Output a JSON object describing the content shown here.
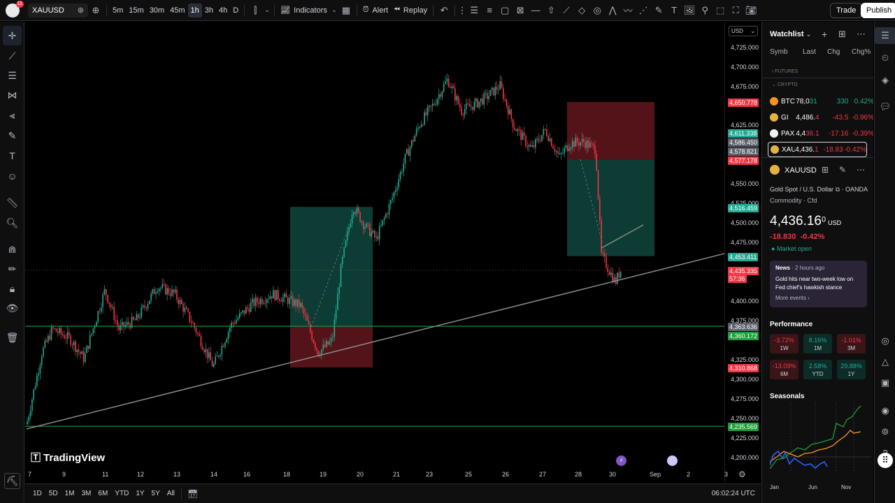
{
  "topbar": {
    "avatar_badge": "11",
    "symbol": "XAUUSD",
    "timeframes": [
      "5m",
      "15m",
      "30m",
      "45m",
      "1h",
      "3h",
      "4h",
      "D"
    ],
    "active_timeframe": "1h",
    "indicators_label": "Indicators",
    "alert_label": "Alert",
    "replay_label": "Replay",
    "trade_label": "Trade",
    "publish_label": "Publish"
  },
  "chart": {
    "currency": "USD",
    "logo_text": "TradingView",
    "price_ticks": [
      "4,725.000",
      "4,700.000",
      "4,675.000",
      "4,625.000",
      "4,550.000",
      "4,525.000",
      "4,500.000",
      "4,475.000",
      "4,400.000",
      "4,375.000",
      "4,325.000",
      "4,300.000",
      "4,275.000",
      "4,250.000",
      "4,225.000",
      "4,200.000"
    ],
    "price_labels": [
      {
        "text": "4,650.778",
        "color": "#f23645"
      },
      {
        "text": "4,611.338",
        "color": "#22ab94"
      },
      {
        "text": "4,586.450",
        "color": "#5d606b"
      },
      {
        "text": "4,578.821",
        "color": "#5d606b"
      },
      {
        "text": "4,577.178",
        "color": "#f23645"
      },
      {
        "text": "4,516.459",
        "color": "#22ab94"
      },
      {
        "text": "4,453.411",
        "color": "#22ab94"
      },
      {
        "text": "4,435.335",
        "color": "#f23645"
      },
      {
        "text": "57:36",
        "color": "#f23645"
      },
      {
        "text": "4,363.636",
        "color": "#5d606b"
      },
      {
        "text": "4,360.172",
        "color": "#1e9e3a"
      },
      {
        "text": "4,310.868",
        "color": "#f23645"
      },
      {
        "text": "4,235.569",
        "color": "#1e9e3a"
      }
    ],
    "time_ticks": [
      "7",
      "9",
      "11",
      "12",
      "13",
      "14",
      "16",
      "18",
      "19",
      "20",
      "21",
      "23",
      "25",
      "26",
      "27",
      "28",
      "30",
      "Sep",
      "2",
      "3"
    ],
    "ranges": [
      "1D",
      "5D",
      "1M",
      "3M",
      "6M",
      "YTD",
      "1Y",
      "5Y",
      "All"
    ],
    "clock": "06:02:24 UTC"
  },
  "watchlist": {
    "title": "Watchlist",
    "columns": [
      "Symb",
      "Last",
      "Chg",
      "Chg%"
    ],
    "group_futures": "FUTURES",
    "group_crypto": "CRYPTO",
    "rows": [
      {
        "sym": "BTC",
        "last_a": "78,0",
        "last_b": "31",
        "chg": "330",
        "chgp": "0.42%",
        "dir": "up",
        "coin": "#f7931a"
      },
      {
        "sym": "GI",
        "last_a": "4,486.",
        "last_b": "4",
        "chg": "-43.5",
        "chgp": "-0.96%",
        "dir": "down",
        "coin": "#e3b341"
      },
      {
        "sym": "PAX",
        "last_a": "4,4",
        "last_b": "36.1",
        "chg": "-17.16",
        "chgp": "-0.39%",
        "dir": "down",
        "coin": "#f1f1f1"
      },
      {
        "sym": "XAU",
        "last_a": "4,436.",
        "last_b": "1",
        "chg": "-18.83",
        "chgp": "-0.42%",
        "dir": "down",
        "coin": "#e3b341"
      }
    ]
  },
  "details": {
    "symbol": "XAUUSD",
    "name": "Gold Spot / U.S. Dollar",
    "exchange": "OANDA",
    "type": "Commodity",
    "subtype": "Cfd",
    "price_main": "4,43",
    "price_big": "6.16",
    "price_small": "0",
    "currency": "USD",
    "change": "-18.830",
    "change_pct": "-0.42%",
    "market_status": "Market open",
    "news_label": "News",
    "news_time": "2 hours ago",
    "news_headline": "Gold hits near two-week low on Fed chief's hawkish stance",
    "news_more": "More events",
    "performance_title": "Performance",
    "performance": [
      {
        "value": "-3.72%",
        "period": "1W",
        "dir": "neg"
      },
      {
        "value": "8.16%",
        "period": "1M",
        "dir": "pos"
      },
      {
        "value": "-1.01%",
        "period": "3M",
        "dir": "neg"
      },
      {
        "value": "-13.09%",
        "period": "6M",
        "dir": "neg"
      },
      {
        "value": "2.58%",
        "period": "YTD",
        "dir": "pos"
      },
      {
        "value": "29.88%",
        "period": "1Y",
        "dir": "pos"
      }
    ],
    "seasonals_title": "Seasonals",
    "seasonal_months": [
      "Jan",
      "Jun",
      "Nov"
    ]
  },
  "colors": {
    "up": "#22ab94",
    "down": "#f23645",
    "support": "#1e9e3a",
    "trendline": "#8a8a8a"
  }
}
